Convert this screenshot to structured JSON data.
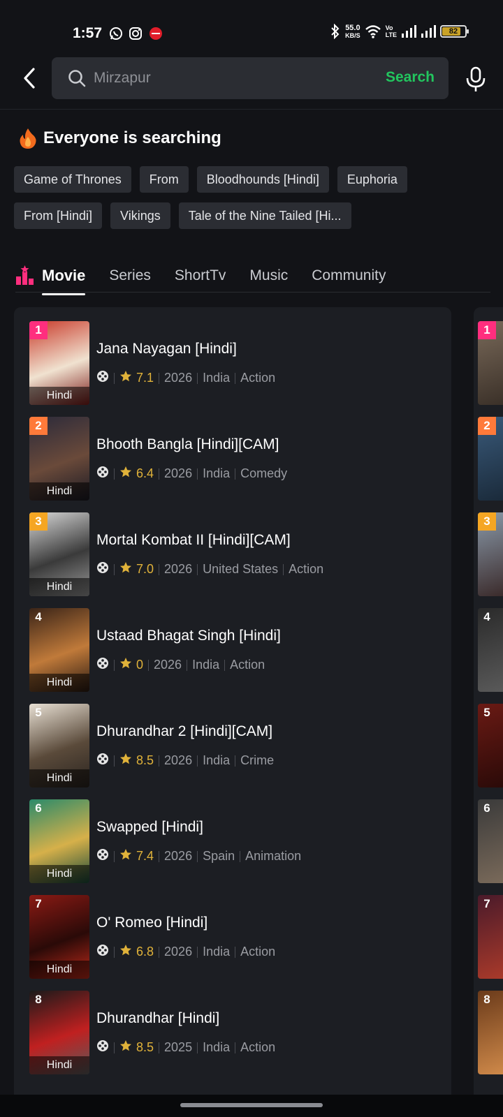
{
  "status_bar": {
    "time": "1:57",
    "net_speed": "55.0",
    "net_unit": "KB/S",
    "volte_1": "Vo",
    "volte_2": "LTE",
    "battery": "82",
    "battery_level": 0.82,
    "icons": [
      "whatsapp-icon",
      "instagram-icon",
      "app-notification-icon",
      "bluetooth-icon",
      "wifi-icon",
      "signal-icon",
      "signal-icon",
      "battery-icon"
    ]
  },
  "search": {
    "value": "",
    "placeholder": "Mirzapur",
    "button_label": "Search"
  },
  "trending": {
    "title": "Everyone is searching",
    "chips_row1": [
      "Game of Thrones",
      "From",
      "Bloodhounds [Hindi]",
      "Euphoria"
    ],
    "chips_row2": [
      "From [Hindi]",
      "Vikings",
      "Tale of the Nine Tailed [Hi..."
    ]
  },
  "tabs": [
    "Movie",
    "Series",
    "ShortTv",
    "Music",
    "Community"
  ],
  "active_tab": "Movie",
  "movies": [
    {
      "rank": "1",
      "title": "Jana Nayagan [Hindi]",
      "rating": "7.1",
      "year": "2026",
      "country": "India",
      "genre": "Action",
      "tag": "Hindi",
      "rank_color": "#ff2e7e",
      "poster": [
        "#c93a2a",
        "#f0e2d0",
        "#7a1a18"
      ]
    },
    {
      "rank": "2",
      "title": "Bhooth Bangla [Hindi][CAM]",
      "rating": "6.4",
      "year": "2026",
      "country": "India",
      "genre": "Comedy",
      "tag": "Hindi",
      "rank_color": "#ff7a3a",
      "poster": [
        "#2b2a3a",
        "#6a4a3a",
        "#1b1a24"
      ]
    },
    {
      "rank": "3",
      "title": "Mortal Kombat II [Hindi][CAM]",
      "rating": "7.0",
      "year": "2026",
      "country": "United States",
      "genre": "Action",
      "tag": "Hindi",
      "rank_color": "#f5a623",
      "poster": [
        "#d8d8d8",
        "#3a3a3a",
        "#9a9a9a"
      ]
    },
    {
      "rank": "4",
      "title": "Ustaad Bhagat Singh [Hindi]",
      "rating": "0",
      "year": "2026",
      "country": "India",
      "genre": "Action",
      "tag": "Hindi",
      "rank_color": "transparent",
      "poster": [
        "#3a2418",
        "#c07a3a",
        "#2a1a12"
      ]
    },
    {
      "rank": "5",
      "title": "Dhurandhar 2 [Hindi][CAM]",
      "rating": "8.5",
      "year": "2026",
      "country": "India",
      "genre": "Crime",
      "tag": "Hindi",
      "rank_color": "transparent",
      "poster": [
        "#e8e0d4",
        "#5a4a3a",
        "#2a2420"
      ]
    },
    {
      "rank": "6",
      "title": "Swapped [Hindi]",
      "rating": "7.4",
      "year": "2026",
      "country": "Spain",
      "genre": "Animation",
      "tag": "Hindi",
      "rank_color": "transparent",
      "poster": [
        "#2a8a6a",
        "#d6b04a",
        "#1a4a3a"
      ]
    },
    {
      "rank": "7",
      "title": "O' Romeo [Hindi]",
      "rating": "6.8",
      "year": "2026",
      "country": "India",
      "genre": "Action",
      "tag": "Hindi",
      "rank_color": "transparent",
      "poster": [
        "#8a1a14",
        "#2a0a08",
        "#c02a1a"
      ]
    },
    {
      "rank": "8",
      "title": "Dhurandhar [Hindi]",
      "rating": "8.5",
      "year": "2025",
      "country": "India",
      "genre": "Action",
      "tag": "Hindi",
      "rank_color": "transparent",
      "poster": [
        "#1a1a1a",
        "#c02020",
        "#5a5a5a"
      ]
    }
  ],
  "second_column_ranks": [
    {
      "rank": "1",
      "color": "#ff2e7e",
      "poster": [
        "#7a6a5a",
        "#3a3028"
      ]
    },
    {
      "rank": "2",
      "color": "#ff7a3a",
      "poster": [
        "#3a5a7a",
        "#1a2a3a"
      ]
    },
    {
      "rank": "3",
      "color": "#f5a623",
      "poster": [
        "#8a9aaa",
        "#3a2a2a"
      ]
    },
    {
      "rank": "4",
      "color": "transparent",
      "poster": [
        "#2a2a2a",
        "#5a5a5a"
      ]
    },
    {
      "rank": "5",
      "color": "transparent",
      "poster": [
        "#6a1a14",
        "#2a0a08"
      ]
    },
    {
      "rank": "6",
      "color": "transparent",
      "poster": [
        "#3a3a3a",
        "#7a6a5a"
      ]
    },
    {
      "rank": "7",
      "color": "transparent",
      "poster": [
        "#4a1a2a",
        "#aa3a2a"
      ]
    },
    {
      "rank": "8",
      "color": "transparent",
      "poster": [
        "#6a3a1a",
        "#d08a4a"
      ]
    }
  ]
}
